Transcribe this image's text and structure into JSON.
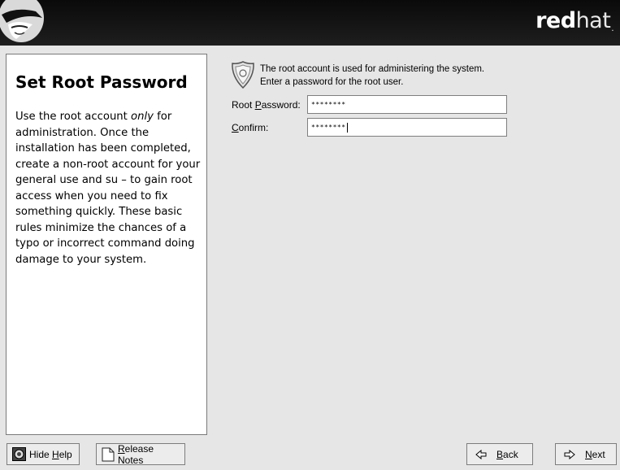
{
  "header": {
    "brand_bold": "red",
    "brand_light": "hat",
    "brand_mark": "."
  },
  "help": {
    "title": "Set Root Password",
    "para_part1": "Use the root account ",
    "para_emph": "only",
    "para_part2": " for administration. Once the installation has been completed, create a non-root account for your general use and su  – to gain root access when you need to fix something quickly. These basic rules minimize the chances of a typo or incorrect command doing damage to your system."
  },
  "info": {
    "line1": "The root account is used for administering the system.",
    "line2": "Enter a password for the root user.",
    "icon": "badge-icon"
  },
  "form": {
    "root_password_label_pre": "Root ",
    "root_password_label_ul": "P",
    "root_password_label_post": "assword:",
    "root_password_value": "********",
    "confirm_label_ul": "C",
    "confirm_label_post": "onfirm:",
    "confirm_value": "********"
  },
  "buttons": {
    "hide_help_pre": "Hide ",
    "hide_help_ul": "H",
    "hide_help_post": "elp",
    "release_notes_ul": "R",
    "release_notes_post": "elease Notes",
    "back_ul": "B",
    "back_post": "ack",
    "next_ul": "N",
    "next_post": "ext"
  }
}
